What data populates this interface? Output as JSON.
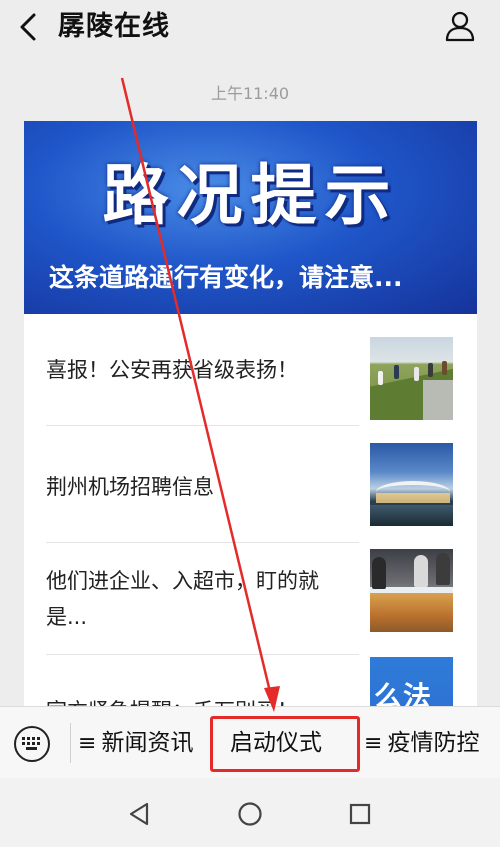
{
  "header": {
    "title": "孱陵在线",
    "back_icon": "chevron-left-icon",
    "profile_icon": "person-icon"
  },
  "timestamp": "上午11:40",
  "card": {
    "banner_title": "路况提示",
    "banner_subtitle": "这条道路通行有变化，请注意...",
    "articles": [
      {
        "title": "喜报！公安再获省级表扬！"
      },
      {
        "title": "荆州机场招聘信息"
      },
      {
        "title": "他们进企业、入超市，盯的就是..."
      },
      {
        "title": "官方紧急提醒：千万别买！"
      }
    ],
    "thumb4_text": "么法"
  },
  "menu": {
    "keyboard_icon": "keyboard-icon",
    "items": [
      {
        "label": "新闻资讯"
      },
      {
        "label": "启动仪式"
      },
      {
        "label": "疫情防控"
      }
    ],
    "bars_glyph": "≡"
  },
  "navbar": {
    "back_icon": "triangle-back-icon",
    "home_icon": "circle-home-icon",
    "recents_icon": "square-recents-icon"
  },
  "colors": {
    "annotation": "#e52a2a",
    "banner": "#1f56c9",
    "background": "#ededed"
  }
}
